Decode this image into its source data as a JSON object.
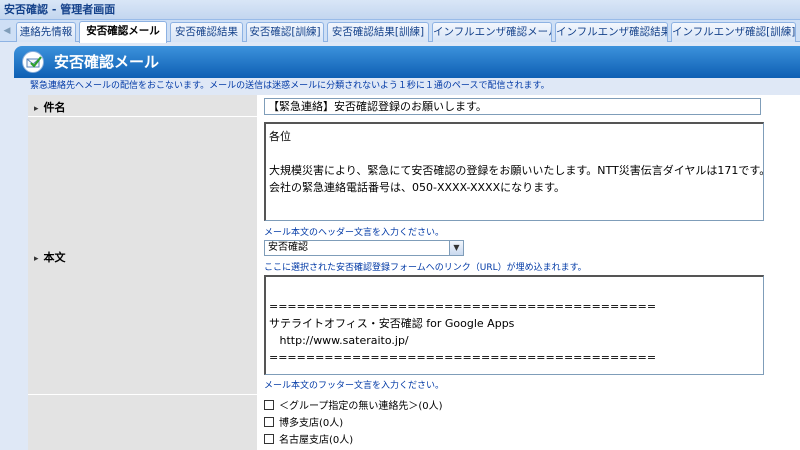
{
  "window": {
    "title": "安否確認 - 管理者画面"
  },
  "tabs": [
    {
      "label": "連絡先情報",
      "active": false
    },
    {
      "label": "安否確認メール",
      "active": true
    },
    {
      "label": "安否確認結果",
      "active": false
    },
    {
      "label": "安否確認[訓練]",
      "active": false
    },
    {
      "label": "安否確認結果[訓練]",
      "active": false
    },
    {
      "label": "インフルエンザ確認メール",
      "active": false
    },
    {
      "label": "インフルエンザ確認結果",
      "active": false
    },
    {
      "label": "インフルエンザ確認[訓練]",
      "active": false
    }
  ],
  "header": {
    "title": "安否確認メール"
  },
  "notice": "緊急連絡先へメールの配信をおこないます。メールの送信は迷惑メールに分類されないよう１秒に１通のペースで配信されます。",
  "form": {
    "subject": {
      "label": "件名",
      "value": "【緊急連絡】安否確認登録のお願いします。"
    },
    "body": {
      "label": "本文",
      "header_text": "各位\n\n大規模災害により、緊急にて安否確認の登録をお願いいたします。NTT災害伝言ダイヤルは171です。\n会社の緊急連絡電話番号は、050-XXXX-XXXXになります。",
      "header_hint": "メール本文のヘッダー文言を入力ください。",
      "form_select": "安否確認",
      "form_hint": "ここに選択された安否確認登録フォームへのリンク（URL）が埋め込まれます。",
      "footer_text": "\n==========================================\nサテライトオフィス・安否確認 for Google Apps\n   http://www.sateraito.jp/\n==========================================",
      "footer_hint": "メール本文のフッター文言を入力ください。"
    },
    "recipients": [
      {
        "label": "＜グループ指定の無い連絡先＞(0人)",
        "checked": false
      },
      {
        "label": "博多支店(0人)",
        "checked": false
      },
      {
        "label": "名古屋支店(0人)",
        "checked": false
      }
    ]
  },
  "colors": {
    "accent": "#0e5fb3",
    "link": "#0039a6",
    "label_bg": "#e3e3e3"
  }
}
